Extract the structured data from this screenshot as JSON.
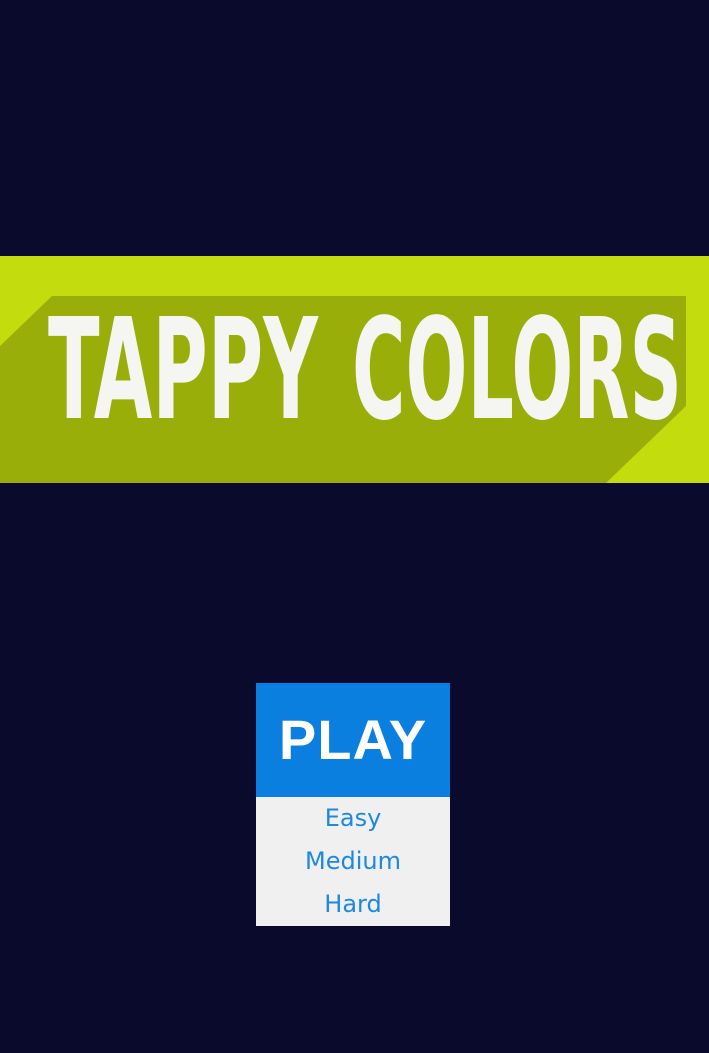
{
  "app": {
    "title": "TAPPY COLORS",
    "title_words": [
      "TAPPY",
      "COLORS"
    ]
  },
  "menu": {
    "play_label": "PLAY",
    "difficulty_options": [
      "Easy",
      "Medium",
      "Hard"
    ]
  },
  "colors": {
    "background": "#0a0b2c",
    "banner": "#c3dc0d",
    "banner_shadow": "#9aae0a",
    "title_text": "#f5f5f2",
    "play_button": "#0b7fdf",
    "play_text": "#ffffff",
    "options_background": "#f0f0f0",
    "options_text": "#1e88e0"
  }
}
